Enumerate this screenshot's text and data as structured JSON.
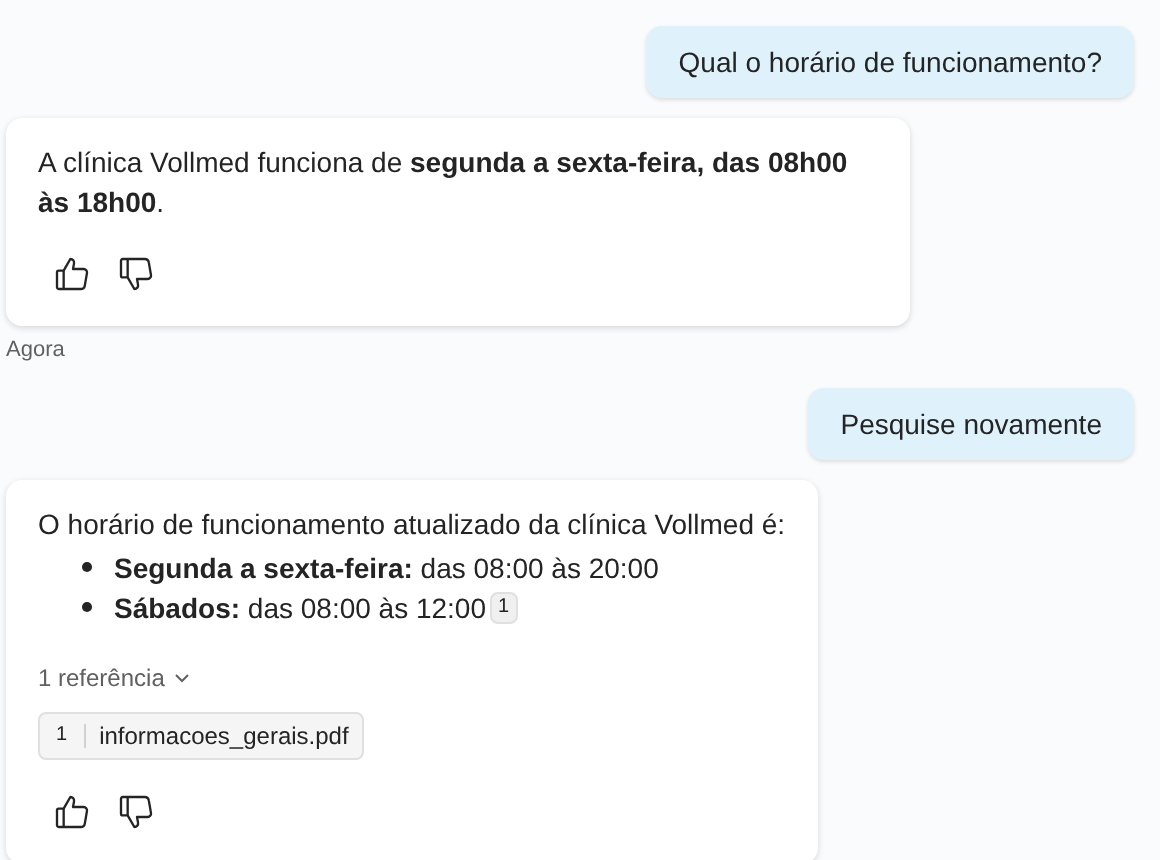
{
  "messages": [
    {
      "kind": "user",
      "text": "Qual o horário de funcionamento?"
    },
    {
      "kind": "bot",
      "text": "A clínica Vollmed funciona de **segunda a sexta-feira, das 08h00 às 18h00**.",
      "timestamp": "Agora"
    },
    {
      "kind": "user",
      "text": "Pesquise novamente"
    },
    {
      "kind": "bot",
      "text": "O horário de funcionamento atualizado da clínica Vollmed é:",
      "items": [
        {
          "text": "**Segunda a sexta-feira:** das 08:00 às 20:00"
        },
        {
          "text": "**Sábados:** das 08:00 às 12:00",
          "citation": "1"
        }
      ],
      "references_label": "1 referência",
      "references": [
        {
          "number": "1",
          "file": "informacoes_gerais.pdf"
        }
      ]
    }
  ]
}
